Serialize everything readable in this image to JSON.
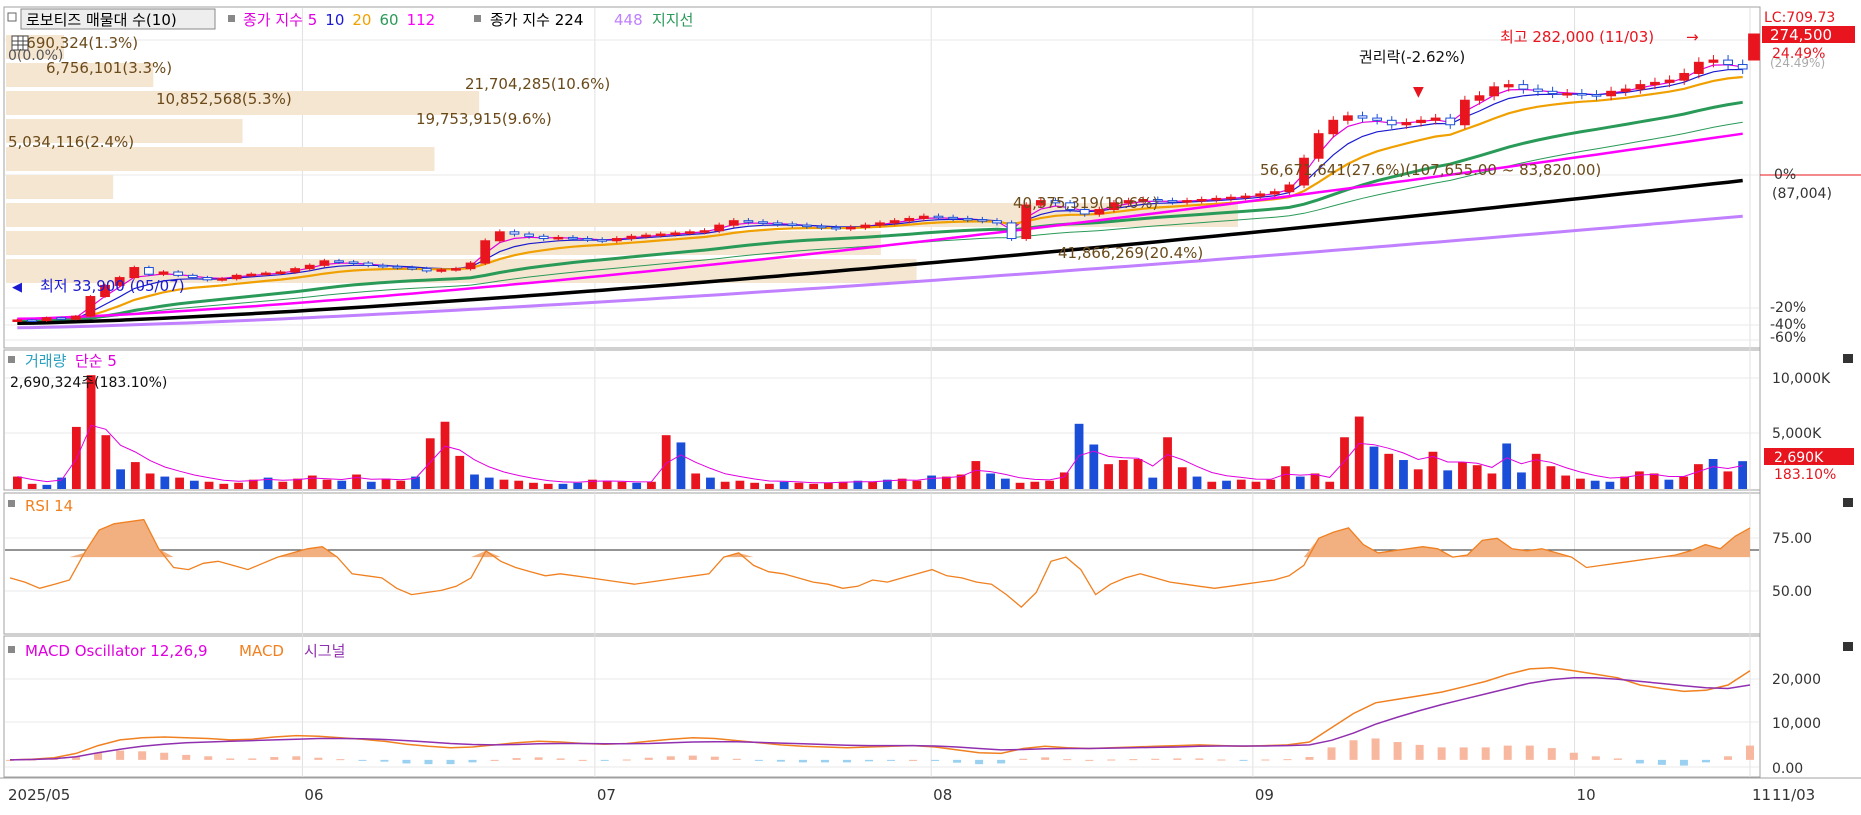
{
  "price_panel": {
    "legend": {
      "selector_label": "로보티즈 매물대 수(10)",
      "ma_prefix": "종가 지수",
      "ma_periods": [
        {
          "label": "5",
          "color": "#E000E0"
        },
        {
          "label": "10",
          "color": "#1a1ad0"
        },
        {
          "label": "20",
          "color": "#f0a000"
        },
        {
          "label": "60",
          "color": "#2a9a58"
        },
        {
          "label": "112",
          "color": "#ff00ff"
        }
      ],
      "ma224_label": "종가 지수 224",
      "ma448_label": "448",
      "support_label": "지지선"
    },
    "price_label": "274,500",
    "lc_label": "LC:709.73",
    "pct_label": "24.49%",
    "pct_label2": "(24.49%)",
    "zero_label": "0%",
    "zero_value": "(87,004)",
    "neg_labels": [
      "-20%",
      "-40%",
      "-60%"
    ],
    "high_annotation": "최고 282,000 (11/03)",
    "low_annotation": "최저 33,900 (05/07)",
    "rights_annotation": "권리락(-2.62%)",
    "top_left_small": "0(0.0%)",
    "volume_profile": [
      {
        "label": "2,690,324(1.3%)",
        "length": 0.013
      },
      {
        "label": "6,756,101(3.3%)",
        "length": 0.033
      },
      {
        "label": "21,704,285(10.6%)",
        "length": 0.106
      },
      {
        "label": "10,852,568(5.3%)",
        "length": 0.053
      },
      {
        "label": "19,753,915(9.6%)",
        "length": 0.096
      },
      {
        "label": "5,034,116(2.4%)",
        "length": 0.024
      },
      {
        "label": "56,671,641(27.6%)(107,655.00 ~ 83,820.00)",
        "length": 0.276
      },
      {
        "label": "40,375,319(19.6%)",
        "length": 0.196
      },
      {
        "label": "41,866,269(20.4%)",
        "length": 0.204
      }
    ]
  },
  "volume_panel": {
    "title_prefix": "거래량",
    "title_ma": "단순 5",
    "current_label": "2,690,324주(183.10%)",
    "axis_labels": [
      "10,000K",
      "5,000K"
    ],
    "badge_value": "2,690K",
    "badge_pct": "183.10%"
  },
  "rsi_panel": {
    "title": "RSI 14",
    "axis_labels": [
      "75.00",
      "50.00"
    ]
  },
  "macd_panel": {
    "title_osc": "MACD Oscillator 12,26,9",
    "title_macd": "MACD",
    "title_signal": "시그널",
    "axis_labels": [
      "20,000",
      "10,000",
      "0.00"
    ]
  },
  "x_axis": {
    "labels": [
      "2025/05",
      "06",
      "07",
      "08",
      "09",
      "10",
      "11"
    ],
    "right_label": "11/03"
  },
  "colors": {
    "up": "#e8141e",
    "down": "#1a4ed8",
    "ma5": "#E000E0",
    "ma10": "#1a1ad0",
    "ma20": "#f0a000",
    "ma60": "#2a9a58",
    "ma112": "#ff00ff",
    "ma224": "#000000",
    "ma448": "#c080ff",
    "volume_profile": "#f5e6d2",
    "rsi": "#f08020",
    "rsi_fill": "#f2b080",
    "macd": "#f08020",
    "signal": "#9030b0",
    "osc_pos": "#f8b8a0",
    "osc_neg": "#9ad0f0"
  },
  "chart_data": [
    {
      "type": "candlestick",
      "title": "로보티즈",
      "x_start": "2025/05",
      "x_end": "11/03",
      "month_ticks": [
        "2025/05",
        "06",
        "07",
        "08",
        "09",
        "10",
        "11"
      ],
      "closes_approx": [
        34500,
        34200,
        35500,
        34800,
        36200,
        45000,
        50000,
        53500,
        58000,
        55000,
        56000,
        54500,
        53500,
        52500,
        53000,
        54500,
        55000,
        55500,
        56000,
        57500,
        59000,
        61000,
        60500,
        60000,
        59000,
        58500,
        58000,
        57500,
        56500,
        57000,
        57500,
        60000,
        70000,
        74000,
        73000,
        72000,
        71000,
        71500,
        71000,
        70500,
        70000,
        71000,
        72000,
        72500,
        73000,
        73500,
        74000,
        74500,
        77000,
        79000,
        78500,
        78000,
        77500,
        77000,
        76500,
        76000,
        75500,
        76000,
        77000,
        78000,
        79000,
        80000,
        81000,
        80500,
        80000,
        79500,
        79000,
        78000,
        71000,
        86000,
        88000,
        87000,
        84000,
        82000,
        84000,
        87000,
        88000,
        88500,
        88000,
        87500,
        88000,
        88500,
        89000,
        89500,
        90000,
        91000,
        92000,
        95000,
        107000,
        118000,
        124000,
        126000,
        125000,
        124000,
        122000,
        123000,
        124000,
        125000,
        122000,
        133000,
        135000,
        139000,
        140000,
        138000,
        137000,
        136000,
        136000,
        135500,
        135000,
        137000,
        138000,
        140000,
        141000,
        142000,
        145000,
        150000,
        151000,
        149000,
        147000
      ],
      "high": {
        "value": 282000,
        "date": "11/03"
      },
      "low": {
        "value": 33900,
        "date": "05/07"
      },
      "last": 274500,
      "reference": 87004,
      "right_axis_pct_ticks": [
        "0%",
        "-20%",
        "-40%",
        "-60%"
      ],
      "moving_averages": [
        "5",
        "10",
        "20",
        "60",
        "112",
        "224",
        "448"
      ],
      "volume_profile_pct": [
        1.3,
        3.3,
        10.6,
        5.3,
        9.6,
        2.4,
        27.6,
        19.6,
        20.4
      ]
    },
    {
      "type": "bar",
      "title": "거래량",
      "series": [
        {
          "name": "거래량",
          "values": [
            1200,
            500,
            400,
            1100,
            6000,
            11000,
            5200,
            1900,
            2600,
            1500,
            1200,
            1100,
            800,
            700,
            500,
            600,
            900,
            1100,
            700,
            1000,
            1300,
            900,
            800,
            1400,
            700,
            1000,
            800,
            1200,
            4900,
            6500,
            3200,
            1400,
            1100,
            900,
            800,
            600,
            500,
            500,
            600,
            900,
            800,
            700,
            600,
            700,
            5200,
            4500,
            1500,
            1100,
            700,
            800,
            600,
            500,
            700,
            600,
            500,
            600,
            700,
            800,
            700,
            900,
            1000,
            800,
            1300,
            1200,
            1400,
            2700,
            1500,
            1000,
            600,
            700,
            800,
            1600,
            6300,
            4300,
            2400,
            2800,
            2900,
            1100,
            5000,
            2100,
            1200,
            700,
            800,
            900,
            700,
            900,
            2200,
            1200,
            1500,
            700,
            5000,
            7000,
            4100,
            3400,
            2800,
            1900,
            3600,
            1800,
            2600,
            2300,
            1500,
            4400,
            1600,
            3400,
            2200,
            1300,
            1000,
            800,
            700,
            1200,
            1700,
            1500,
            900,
            1200,
            2400,
            2900,
            1700,
            2690
          ]
        }
      ],
      "axis_ticks": [
        "10,000K",
        "5,000K"
      ],
      "last_value": "2,690K",
      "last_pct": "183.10%"
    },
    {
      "type": "line",
      "title": "RSI 14",
      "reference_line": 70,
      "axis_ticks": [
        75,
        50
      ],
      "series": [
        {
          "name": "RSI 14",
          "values": [
            60,
            58,
            55,
            57,
            59,
            72,
            83,
            86,
            87,
            88,
            74,
            65,
            64,
            67,
            68,
            66,
            64,
            67,
            70,
            72,
            74,
            75,
            70,
            62,
            61,
            60,
            55,
            52,
            53,
            54,
            56,
            60,
            73,
            68,
            65,
            63,
            61,
            62,
            61,
            60,
            59,
            58,
            57,
            58,
            59,
            60,
            61,
            62,
            70,
            72,
            66,
            63,
            62,
            60,
            58,
            57,
            55,
            56,
            59,
            58,
            60,
            62,
            64,
            61,
            60,
            58,
            57,
            52,
            46,
            53,
            68,
            70,
            64,
            52,
            57,
            60,
            62,
            60,
            58,
            57,
            56,
            55,
            56,
            57,
            58,
            59,
            61,
            66,
            79,
            82,
            84,
            76,
            72,
            73,
            74,
            75,
            74,
            70,
            71,
            78,
            79,
            74,
            73,
            74,
            72,
            70,
            65,
            66,
            67,
            68,
            69,
            70,
            71,
            73,
            76,
            74,
            80,
            84
          ]
        }
      ]
    },
    {
      "type": "line",
      "title": "MACD Oscillator 12,26,9",
      "axis_ticks": [
        20000,
        10000,
        0
      ],
      "series": [
        {
          "name": "MACD",
          "values": [
            0,
            200,
            600,
            1800,
            4000,
            5600,
            6200,
            6400,
            6200,
            6000,
            5600,
            5800,
            6400,
            6800,
            6600,
            6200,
            5800,
            5200,
            4400,
            3800,
            3400,
            3600,
            4200,
            4800,
            5200,
            5000,
            4600,
            4400,
            4600,
            5200,
            5800,
            6200,
            6000,
            5400,
            4800,
            4200,
            3800,
            3600,
            3400,
            3600,
            3800,
            4000,
            3600,
            2800,
            2000,
            1800,
            3200,
            3800,
            3400,
            3200,
            3400,
            3600,
            3800,
            4000,
            4200,
            4000,
            3800,
            4000,
            4200,
            5000,
            9000,
            13000,
            16000,
            17000,
            18000,
            19000,
            20500,
            22000,
            24000,
            25500,
            25800,
            25000,
            24000,
            23000,
            21000,
            20000,
            19200,
            19500,
            21000,
            25000
          ]
        },
        {
          "name": "시그널",
          "values": [
            0,
            100,
            300,
            900,
            2000,
            3000,
            3800,
            4400,
            4800,
            5000,
            5200,
            5400,
            5600,
            5800,
            6000,
            6000,
            5900,
            5700,
            5400,
            5000,
            4600,
            4300,
            4200,
            4300,
            4500,
            4600,
            4600,
            4500,
            4500,
            4600,
            4800,
            5000,
            5100,
            5100,
            4900,
            4700,
            4500,
            4300,
            4100,
            4000,
            4000,
            4000,
            3900,
            3600,
            3200,
            2800,
            2900,
            3100,
            3200,
            3200,
            3300,
            3400,
            3500,
            3600,
            3800,
            3900,
            3900,
            3900,
            4000,
            4200,
            5500,
            7500,
            10000,
            12000,
            13800,
            15500,
            17000,
            18500,
            20000,
            21500,
            22500,
            23000,
            23000,
            22600,
            22000,
            21400,
            20800,
            20200,
            20000,
            21000
          ]
        }
      ],
      "oscillator": [
        0,
        100,
        300,
        900,
        2000,
        2600,
        2400,
        2000,
        1400,
        1000,
        400,
        400,
        800,
        1000,
        600,
        200,
        -100,
        -500,
        -1000,
        -1200,
        -1200,
        -700,
        0,
        500,
        700,
        400,
        0,
        -100,
        100,
        600,
        1000,
        1200,
        900,
        300,
        -100,
        -500,
        -700,
        -700,
        -700,
        -400,
        -200,
        0,
        -300,
        -800,
        -1200,
        -1000,
        300,
        700,
        200,
        0,
        100,
        200,
        300,
        400,
        400,
        100,
        -100,
        100,
        200,
        800,
        3500,
        5500,
        6000,
        5000,
        4200,
        3500,
        3500,
        3500,
        4000,
        4000,
        3300,
        2000,
        1000,
        400,
        -1000,
        -1400,
        -1600,
        -700,
        1000,
        4000
      ]
    }
  ]
}
